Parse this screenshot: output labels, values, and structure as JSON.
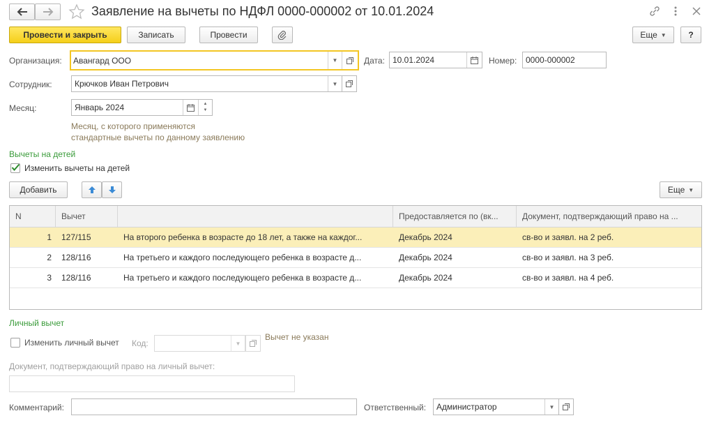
{
  "header": {
    "title": "Заявление на вычеты по НДФЛ 0000-000002 от 10.01.2024"
  },
  "toolbar": {
    "post_close": "Провести и закрыть",
    "save": "Записать",
    "post": "Провести",
    "more": "Еще",
    "help": "?"
  },
  "form": {
    "org_label": "Организация:",
    "org_value": "Авангард ООО",
    "date_label": "Дата:",
    "date_value": "10.01.2024",
    "number_label": "Номер:",
    "number_value": "0000-000002",
    "employee_label": "Сотрудник:",
    "employee_value": "Крючков Иван Петрович",
    "month_label": "Месяц:",
    "month_value": "Январь 2024",
    "month_hint_1": "Месяц, с которого применяются",
    "month_hint_2": "стандартные вычеты по данному заявлению"
  },
  "children": {
    "section_title": "Вычеты на детей",
    "change_checkbox": "Изменить вычеты на детей",
    "change_checked": true,
    "add_button": "Добавить",
    "more": "Еще",
    "columns": [
      "N",
      "Вычет",
      "",
      "Предоставляется по (вк...",
      "Документ, подтверждающий право на ..."
    ],
    "rows": [
      {
        "n": "1",
        "code": "127/115",
        "desc": "На второго ребенка в возрасте до 18 лет, а также на каждог...",
        "until": "Декабрь 2024",
        "doc": "св-во и заявл. на 2 реб.",
        "selected": true
      },
      {
        "n": "2",
        "code": "128/116",
        "desc": "На третьего и каждого последующего ребенка в возрасте д...",
        "until": "Декабрь 2024",
        "doc": "св-во и заявл. на 3 реб.",
        "selected": false
      },
      {
        "n": "3",
        "code": "128/116",
        "desc": "На третьего и каждого последующего ребенка в возрасте д...",
        "until": "Декабрь 2024",
        "doc": "св-во и заявл. на 4 реб.",
        "selected": false
      }
    ]
  },
  "personal": {
    "section_title": "Личный вычет",
    "change_checkbox": "Изменить личный вычет",
    "code_label": "Код:",
    "code_value": "",
    "not_specified": "Вычет не указан",
    "doc_label": "Документ, подтверждающий право на личный вычет:",
    "doc_value": ""
  },
  "footer": {
    "comment_label": "Комментарий:",
    "comment_value": "",
    "responsible_label": "Ответственный:",
    "responsible_value": "Администратор"
  }
}
